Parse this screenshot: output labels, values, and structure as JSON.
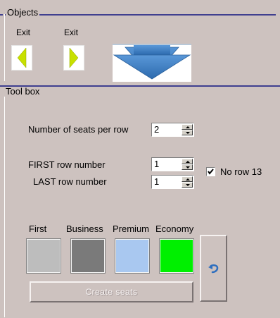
{
  "objects": {
    "legend": "Objects",
    "exit_left_label": "Exit",
    "exit_right_label": "Exit",
    "exit_arrow_color": "#c8e000",
    "down_arrow_color": "#3d7fc4"
  },
  "toolbox": {
    "legend": "Tool box",
    "seats_per_row": {
      "label": "Number of seats per row",
      "value": "2"
    },
    "first_row": {
      "label": "FIRST row number",
      "value": "1"
    },
    "last_row": {
      "label": "LAST row number",
      "value": "1"
    },
    "no_row_13": {
      "label": "No row 13",
      "checked": true
    },
    "classes": [
      {
        "label": "First",
        "color": "#bdbdbd"
      },
      {
        "label": "Business",
        "color": "#7a7a7a"
      },
      {
        "label": "Premium",
        "color": "#a9c8f0"
      },
      {
        "label": "Economy",
        "color": "#00f000"
      }
    ],
    "create_seats_label": "Create  seats",
    "undo_icon": "undo-icon"
  }
}
